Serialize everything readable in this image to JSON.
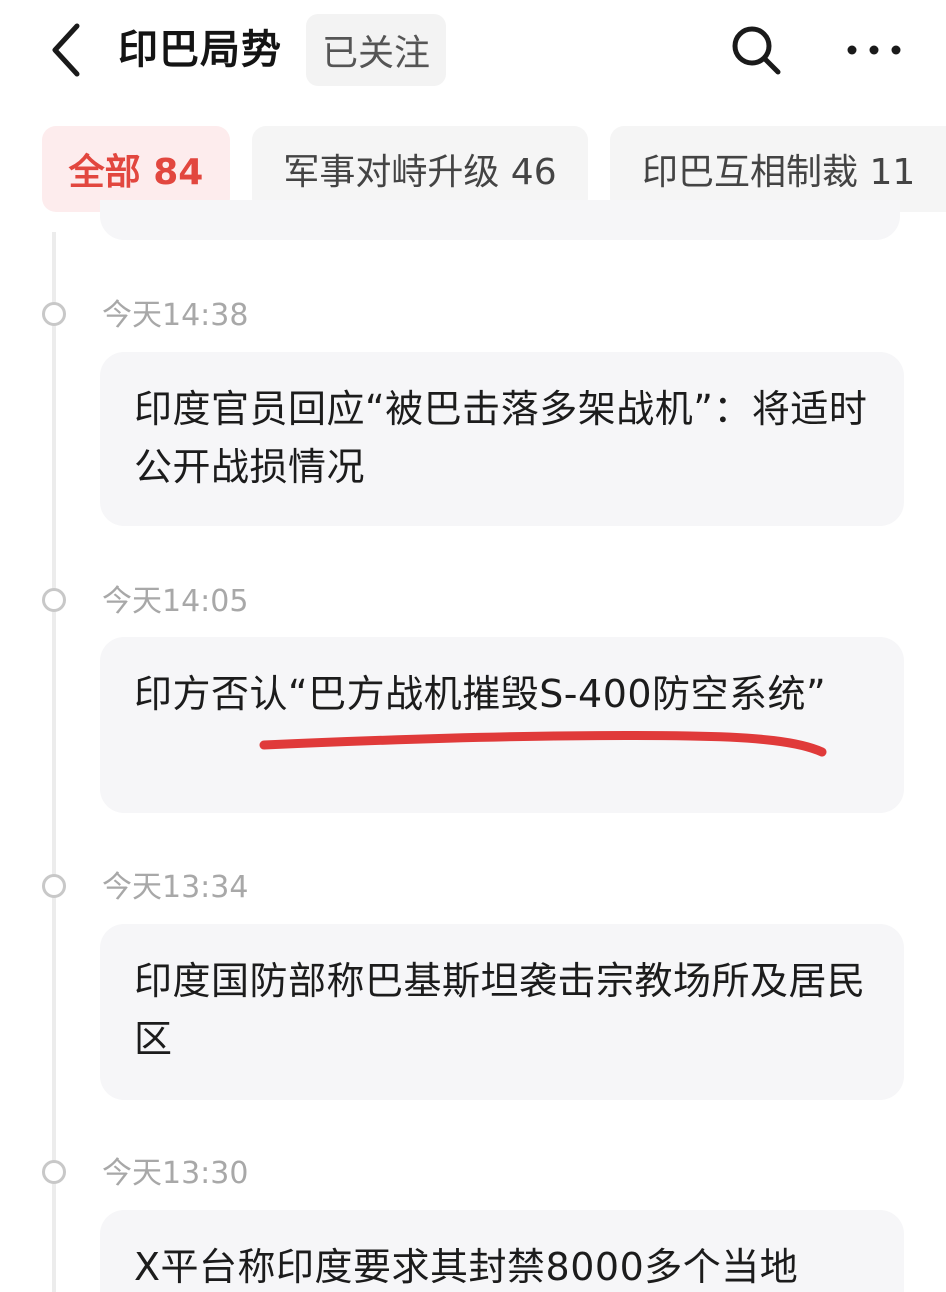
{
  "header": {
    "back_icon": "chevron-left-icon",
    "title": "印巴局势",
    "follow_label": "已关注",
    "search_icon": "search-icon",
    "more_icon": "more-horizontal-icon"
  },
  "tabs": [
    {
      "label": "全部 84",
      "active": true
    },
    {
      "label": "军事对峙升级 46",
      "active": false
    },
    {
      "label": "印巴互相制裁 11",
      "active": false
    }
  ],
  "timeline": [
    {
      "time": "今天14:38",
      "headline": "印度官员回应“被巴击落多架战机”：将适时公开战损情况"
    },
    {
      "time": "今天14:05",
      "headline": "印方否认“巴方战机摧毁S-400防空系统”"
    },
    {
      "time": "今天13:34",
      "headline": "印度国防部称巴基斯坦袭击宗教场所及居民区"
    },
    {
      "time": "今天13:30",
      "headline": "X平台称印度要求其封禁8000多个当地"
    }
  ],
  "colors": {
    "accent": "#e2473f",
    "active_tab_bg": "#fdeced",
    "card_bg": "#f6f6f8",
    "annotation_stroke": "#e03a3a"
  }
}
